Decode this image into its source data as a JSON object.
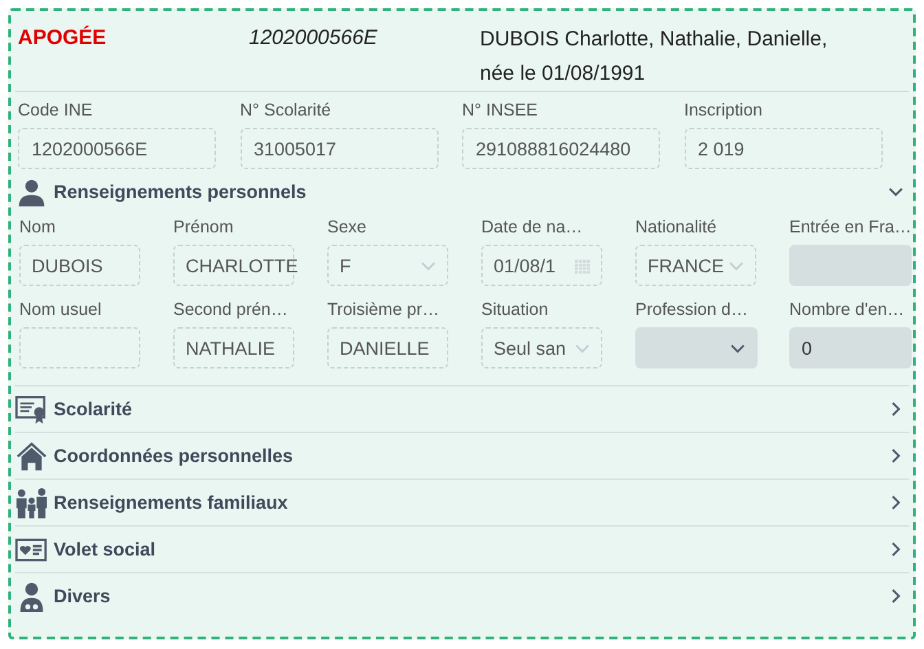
{
  "header": {
    "brand": "APOGÉE",
    "code": "1202000566E",
    "name_lines": [
      "DUBOIS Charlotte, Nathalie, Danielle,",
      "née le 01/08/1991"
    ]
  },
  "identifiers": [
    {
      "label": "Code INE",
      "value": "1202000566E"
    },
    {
      "label": "N° Scolarité",
      "value": "31005017"
    },
    {
      "label": "N° INSEE",
      "value": "291088816024480"
    },
    {
      "label": "Inscription",
      "value": "2 019"
    }
  ],
  "sections": [
    {
      "title": "Renseignements personnels",
      "expanded": true,
      "fields": [
        {
          "label": "Nom",
          "value": "DUBOIS",
          "kind": "text",
          "editable": false
        },
        {
          "label": "Prénom",
          "value": "CHARLOTTE",
          "kind": "text",
          "editable": false
        },
        {
          "label": "Sexe",
          "value": "F",
          "kind": "select",
          "editable": false
        },
        {
          "label": "Date de na…",
          "value": "01/08/1",
          "kind": "date",
          "editable": false
        },
        {
          "label": "Nationalité",
          "value": "FRANCE",
          "kind": "select",
          "editable": false
        },
        {
          "label": "Entrée en Fra…",
          "kind": "text",
          "editable": true
        },
        {
          "label": "Nom usuel",
          "kind": "text",
          "editable": false
        },
        {
          "label": "Second prén…",
          "value": "NATHALIE",
          "kind": "text",
          "editable": false
        },
        {
          "label": "Troisième pr…",
          "value": "DANIELLE",
          "kind": "text",
          "editable": false
        },
        {
          "label": "Situation",
          "value": "Seul san",
          "kind": "select",
          "editable": false
        },
        {
          "label": "Profession d…",
          "kind": "select",
          "editable": true
        },
        {
          "label": "Nombre d'en…",
          "value": "0",
          "kind": "text",
          "editable": true
        }
      ]
    },
    {
      "title": "Scolarité",
      "expanded": false
    },
    {
      "title": "Coordonnées personnelles",
      "expanded": false
    },
    {
      "title": "Renseignements familiaux",
      "expanded": false
    },
    {
      "title": "Volet social",
      "expanded": false
    },
    {
      "title": "Divers",
      "expanded": false
    }
  ]
}
